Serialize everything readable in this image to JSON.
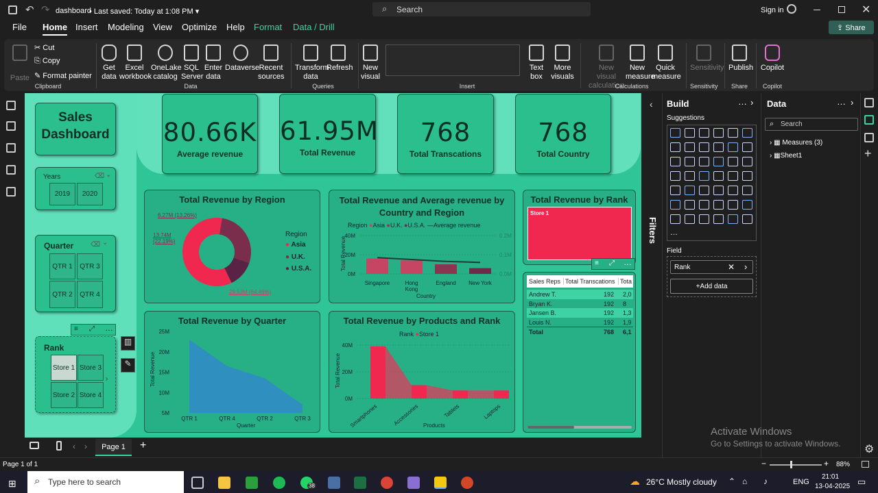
{
  "app": {
    "file": "dashboard",
    "saved": "Last saved: Today at 1:08 PM",
    "search": "Search",
    "signin": "Sign in"
  },
  "menu": [
    "File",
    "Home",
    "Insert",
    "Modeling",
    "View",
    "Optimize",
    "Help",
    "Format",
    "Data / Drill"
  ],
  "share": "Share",
  "ribbon": {
    "paste": "Paste",
    "cut": "Cut",
    "copy": "Copy",
    "format_painter": "Format painter",
    "clipboard": "Clipboard",
    "get_data": "Get data",
    "excel": "Excel workbook",
    "onelake": "OneLake catalog",
    "sql": "SQL Server",
    "enter": "Enter data",
    "dataverse": "Dataverse",
    "recent": "Recent sources",
    "data": "Data",
    "transform": "Transform data",
    "refresh": "Refresh",
    "queries": "Queries",
    "new_visual": "New visual",
    "text_box": "Text box",
    "more_visuals": "More visuals",
    "insert": "Insert",
    "new_visual_calc": "New visual calculation",
    "new_measure": "New measure",
    "quick_measure": "Quick measure",
    "calculations": "Calculations",
    "sensitivity": "Sensitivity",
    "sensitivity_grp": "Sensitivity",
    "publish": "Publish",
    "share_grp": "Share",
    "copilot": "Copilot",
    "copilot_grp": "Copilot"
  },
  "dashboard": {
    "title_line1": "Sales",
    "title_line2": "Dashboard",
    "years": {
      "label": "Years",
      "items": [
        "2019",
        "2020"
      ]
    },
    "quarter": {
      "label": "Quarter",
      "items": [
        "QTR 1",
        "QTR 3",
        "QTR 2",
        "QTR 4"
      ]
    },
    "rank": {
      "label": "Rank",
      "items": [
        "Store 1",
        "Store 3",
        "Store 2",
        "Store 4"
      ]
    },
    "kpis": [
      {
        "value": "80.66K",
        "label": "Average revenue"
      },
      {
        "value": "61.95M",
        "label": "Total Revenue"
      },
      {
        "value": "768",
        "label": "Total Transcations"
      },
      {
        "value": "768",
        "label": "Total Country"
      }
    ],
    "region_title": "Total Revenue by Region",
    "region_legend_title": "Region",
    "region_legend": [
      "Asia",
      "U.K.",
      "U.S.A."
    ],
    "region_labels": [
      "6.27M (13.26%)",
      "13.74M (22.19%)",
      "29.53M (64.46%)"
    ],
    "country_title": "Total Revenue and Average revenue by Country and Region",
    "country_legend_title": "Region",
    "country_legend": [
      "Asia",
      "U.K.",
      "U.S.A.",
      "Average revenue"
    ],
    "country_y_label": "Total Revenue",
    "country_x_label": "Country",
    "country_y_ticks": [
      "40M",
      "20M",
      "0M"
    ],
    "country_y2_ticks": [
      "0.2M",
      "0.1M",
      "0.0M"
    ],
    "country_cats": [
      "Singapore",
      "Hong Kong",
      "England",
      "New York"
    ],
    "rank_title": "Total Revenue by Rank",
    "rank_tile": "Store 1",
    "table": {
      "headers": [
        "Sales Reps",
        "Total Transcations",
        "Tota"
      ],
      "rows": [
        [
          "Andrew T.",
          "192",
          "2,0"
        ],
        [
          "Bryan K.",
          "192",
          "8"
        ],
        [
          "Jansen B.",
          "192",
          "1,3"
        ],
        [
          "Louis N.",
          "192",
          "1,9"
        ]
      ],
      "total": [
        "Total",
        "768",
        "6,1"
      ]
    },
    "quarter_chart_title": "Total Revenue by Quarter",
    "quarter_y_label": "Total Revenue",
    "quarter_x_label": "Quarter",
    "quarter_y_ticks": [
      "25M",
      "20M",
      "15M",
      "10M",
      "5M"
    ],
    "products_title": "Total Revenue by Products and Rank",
    "products_legend_title": "Rank",
    "products_legend": [
      "Store 1"
    ],
    "products_y_label": "Total Revenue",
    "products_x_label": "Products",
    "products_y_ticks": [
      "40M",
      "20M",
      "0M"
    ]
  },
  "chart_data": [
    {
      "type": "pie",
      "title": "Total Revenue by Region",
      "categories": [
        "Asia",
        "U.K.",
        "U.S.A."
      ],
      "values": [
        29.53,
        13.74,
        6.27
      ],
      "labels": [
        "29.53M (64.46%)",
        "13.74M (22.19%)",
        "6.27M (13.26%)"
      ],
      "colors": [
        "#f0274f",
        "#7b2d4c",
        "#5a2345"
      ]
    },
    {
      "type": "bar",
      "title": "Total Revenue and Average revenue by Country and Region",
      "categories": [
        "Singapore",
        "Hong Kong",
        "England",
        "New York"
      ],
      "series": [
        {
          "name": "Total Revenue",
          "values": [
            16,
            14,
            10,
            6
          ]
        },
        {
          "name": "Average revenue",
          "values": [
            0.085,
            0.075,
            0.065,
            0.06
          ]
        }
      ],
      "ylim": [
        0,
        40
      ],
      "colors": [
        "#c64563",
        "#c64563",
        "#8a3650",
        "#6d2b49"
      ]
    },
    {
      "type": "area",
      "title": "Total Revenue by Quarter",
      "categories": [
        "QTR 1",
        "QTR 4",
        "QTR 2",
        "QTR 3"
      ],
      "values": [
        23,
        16.5,
        13.5,
        7
      ],
      "ylim": [
        5,
        25
      ]
    },
    {
      "type": "area",
      "title": "Total Revenue by Products and Rank",
      "categories": [
        "Smartphones",
        "Accessories",
        "Tablets",
        "Laptops"
      ],
      "series": [
        {
          "name": "Store 1",
          "values": [
            39,
            10,
            6,
            6
          ]
        }
      ],
      "ylim": [
        0,
        40
      ]
    }
  ],
  "filters_label": "Filters",
  "build": {
    "title": "Build",
    "suggestions": "Suggestions",
    "field_label": "Field",
    "field_value": "Rank",
    "add_data": "+Add data"
  },
  "data_pane": {
    "title": "Data",
    "search": "Search",
    "items": [
      "Measures (3)",
      "Sheet1"
    ]
  },
  "pages": {
    "tab": "Page 1",
    "status": "Page 1 of 1",
    "zoom": "88%"
  },
  "activate": {
    "l1": "Activate Windows",
    "l2": "Go to Settings to activate Windows."
  },
  "taskbar": {
    "search": "Type here to search",
    "weather": "26°C  Mostly cloudy",
    "lang": "ENG",
    "time": "21:01",
    "date": "13-04-2025",
    "badge": "38"
  }
}
